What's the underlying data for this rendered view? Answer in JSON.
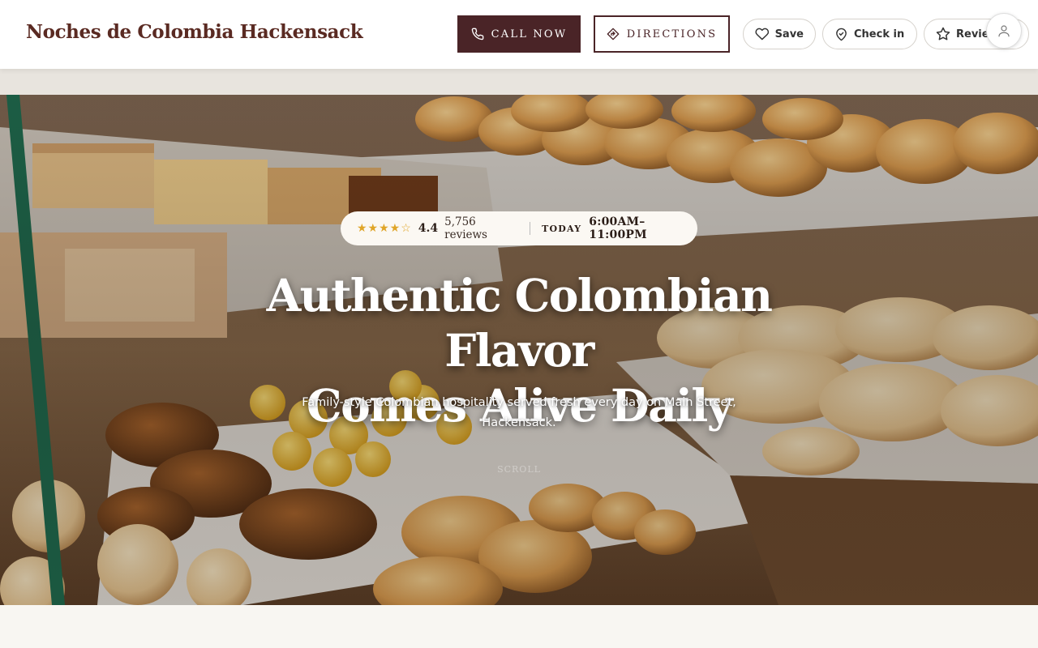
{
  "header": {
    "brand": "Noches de Colombia Hackensack",
    "call_label": "CALL NOW",
    "directions_label": "DIRECTIONS",
    "save_label": "Save",
    "checkin_label": "Check in",
    "review_label": "Review"
  },
  "hero": {
    "stars": "★★★★☆",
    "rating": "4.4",
    "reviews": "5,756 reviews",
    "today_label": "TODAY",
    "hours": "6:00AM–11:00PM",
    "headline_line1": "Authentic Colombian Flavor",
    "headline_line2": "Comes Alive Daily",
    "subline": "Family-style Colombian hospitality served fresh every day on Main Street, Hackensack.",
    "scroll_hint": "SCROLL"
  },
  "icons": {
    "call": "phone-icon",
    "directions": "directions-icon",
    "save": "heart-icon",
    "checkin": "map-pin-icon",
    "review": "star-icon",
    "account": "user-icon"
  },
  "colors": {
    "brand": "#5a2a22",
    "primary_button": "#4a2427",
    "star": "#e0a528"
  }
}
